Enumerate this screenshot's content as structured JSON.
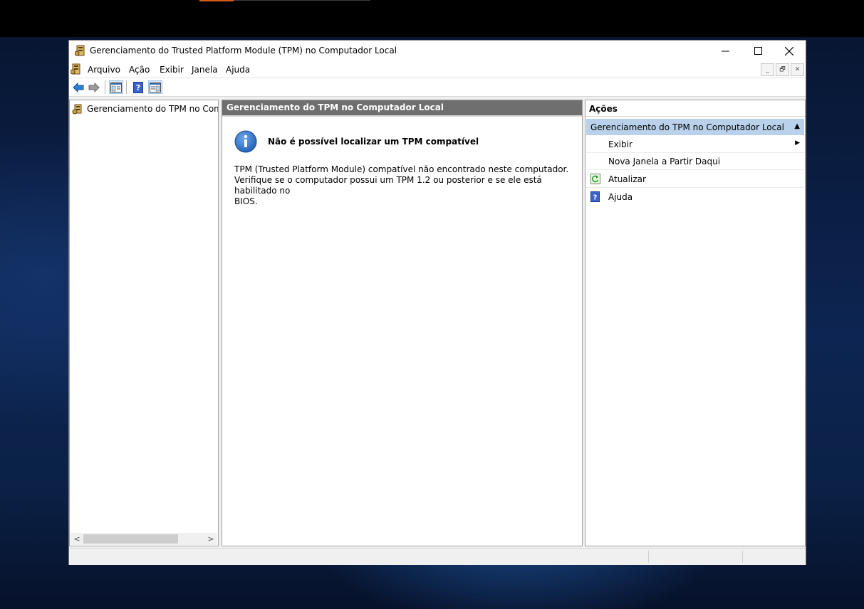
{
  "window": {
    "title": "Gerenciamento do Trusted Platform Module (TPM) no Computador Local",
    "caption_buttons": {
      "minimize": "—",
      "maximize": "☐",
      "close": "✕"
    }
  },
  "menu": {
    "items": [
      "Arquivo",
      "Ação",
      "Exibir",
      "Janela",
      "Ajuda"
    ],
    "mdi_buttons": [
      "_",
      "🗗",
      "✕"
    ]
  },
  "toolbar": {
    "buttons": [
      "back-arrow-icon",
      "forward-arrow-icon",
      "show-hide-console-tree-icon",
      "help-icon",
      "show-hide-action-pane-icon"
    ]
  },
  "tree": {
    "root_label": "Gerenciamento do TPM no Compu"
  },
  "result": {
    "header": "Gerenciamento do TPM no Computador Local",
    "message_title": "Não é possível localizar um TPM compatível",
    "message_body_line1": "TPM (Trusted Platform Module) compatível não encontrado neste computador.",
    "message_body_line2": "Verifique se o computador possui um TPM 1.2 ou posterior e se ele está habilitado no",
    "message_body_line3": "BIOS."
  },
  "actions": {
    "header": "Ações",
    "section_title": "Gerenciamento do TPM no Computador Local",
    "collapse_glyph": "▲",
    "submenu_glyph": "▶",
    "items": [
      {
        "label": "Exibir",
        "icon": "none",
        "has_submenu": true
      },
      {
        "label": "Nova Janela a Partir Daqui",
        "icon": "none",
        "has_submenu": false
      },
      {
        "label": "Atualizar",
        "icon": "refresh-icon",
        "has_submenu": false
      },
      {
        "label": "Ajuda",
        "icon": "help-icon",
        "has_submenu": false
      }
    ]
  },
  "colors": {
    "result_header_bg": "#6f6f6f",
    "actions_section_bg": "#b9d1ea",
    "info_icon_blue": "#1f5fb4"
  }
}
